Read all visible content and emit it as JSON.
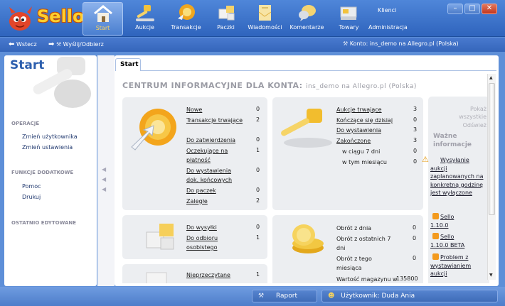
{
  "app": {
    "logo_text": "Sello"
  },
  "toolbar": {
    "items": [
      {
        "label": "Start",
        "icon": "home-icon"
      },
      {
        "label": "Aukcje",
        "icon": "gavel-icon"
      },
      {
        "label": "Transakcje",
        "icon": "transaction-icon"
      },
      {
        "label": "Paczki",
        "icon": "package-icon"
      },
      {
        "label": "Wiadomości",
        "icon": "envelope-icon"
      },
      {
        "label": "Komentarze",
        "icon": "comments-icon"
      },
      {
        "label": "Towary",
        "icon": "goods-icon"
      }
    ],
    "clients_label": "Klienci",
    "admin_label": "Administracja"
  },
  "window": {
    "minimize": "–",
    "maximize": "□",
    "close": "✕"
  },
  "navbar": {
    "back_label": "Wstecz",
    "send_receive_label": "Wyślij/Odbierz",
    "account_label": "Konto: ins_demo na Allegro.pl (Polska)"
  },
  "sidebar": {
    "title": "Start",
    "sections": [
      {
        "title": "OPERACJE",
        "links": [
          "Zmień użytkownika",
          "Zmień ustawienia"
        ]
      },
      {
        "title": "FUNKCJE DODATKOWE",
        "links": [
          "Pomoc",
          "Drukuj"
        ]
      },
      {
        "title": "OSTATNIO EDYTOWANE",
        "links": []
      }
    ]
  },
  "tab": {
    "label": "Start"
  },
  "content": {
    "heading": "CENTRUM INFORMACYJNE  DLA KONTA:",
    "account": "ins_demo na Allegro.pl (Polska)",
    "transactions": [
      {
        "label": "Nowe",
        "value": "0"
      },
      {
        "label": "Transakcje trwające",
        "value": "2"
      },
      {
        "label": "Do zatwierdzenia",
        "value": "0"
      },
      {
        "label": "Oczekujące na płatność",
        "value": "1"
      },
      {
        "label": "Do wystawienia dok. końcowych",
        "value": "0"
      },
      {
        "label": "Do paczek",
        "value": "0"
      },
      {
        "label": "Zaległe",
        "value": "2"
      }
    ],
    "auctions": [
      {
        "label": "Aukcje trwające",
        "value": "3"
      },
      {
        "label": "Kończące się dzisiaj",
        "value": "0"
      },
      {
        "label": "Do wystawienia",
        "value": "3"
      },
      {
        "label": "Zakończone",
        "value": "3"
      },
      {
        "label": "w ciągu 7 dni",
        "value": "0"
      },
      {
        "label": "w tym miesiącu",
        "value": "0"
      }
    ],
    "packages": [
      {
        "label": "Do wysyłki",
        "value": "0"
      },
      {
        "label": "Do odbioru osobistego",
        "value": "1"
      }
    ],
    "turnover": [
      {
        "label": "Obrót z dnia",
        "value": "0"
      },
      {
        "label": "Obrót z ostatnich 7 dni",
        "value": "0"
      },
      {
        "label": "Obrót z tego miesiąca",
        "value": "0"
      },
      {
        "label": "Wartość magazynu w",
        "value": "135800"
      }
    ],
    "messages": [
      {
        "label": "Nieprzeczytane",
        "value": "1"
      }
    ]
  },
  "info": {
    "show_all": "Pokaż wszystkie",
    "refresh": "Odśwież",
    "title": "Ważne informacje",
    "news": [
      {
        "icon": "warning-icon",
        "text": "Wysyłanie aukcji zaplanowanych na konkretną godzinę jest wyłączone"
      },
      {
        "icon": "rss-icon",
        "text": "Sello 1.10.0"
      },
      {
        "icon": "rss-icon",
        "text": "Sello 1.10.0 BETA"
      },
      {
        "icon": "rss-icon",
        "text": "Problem z wystawianiem aukcji"
      }
    ]
  },
  "statusbar": {
    "report_label": "Raport",
    "user_label": "Użytkownik: Duda Ania"
  }
}
